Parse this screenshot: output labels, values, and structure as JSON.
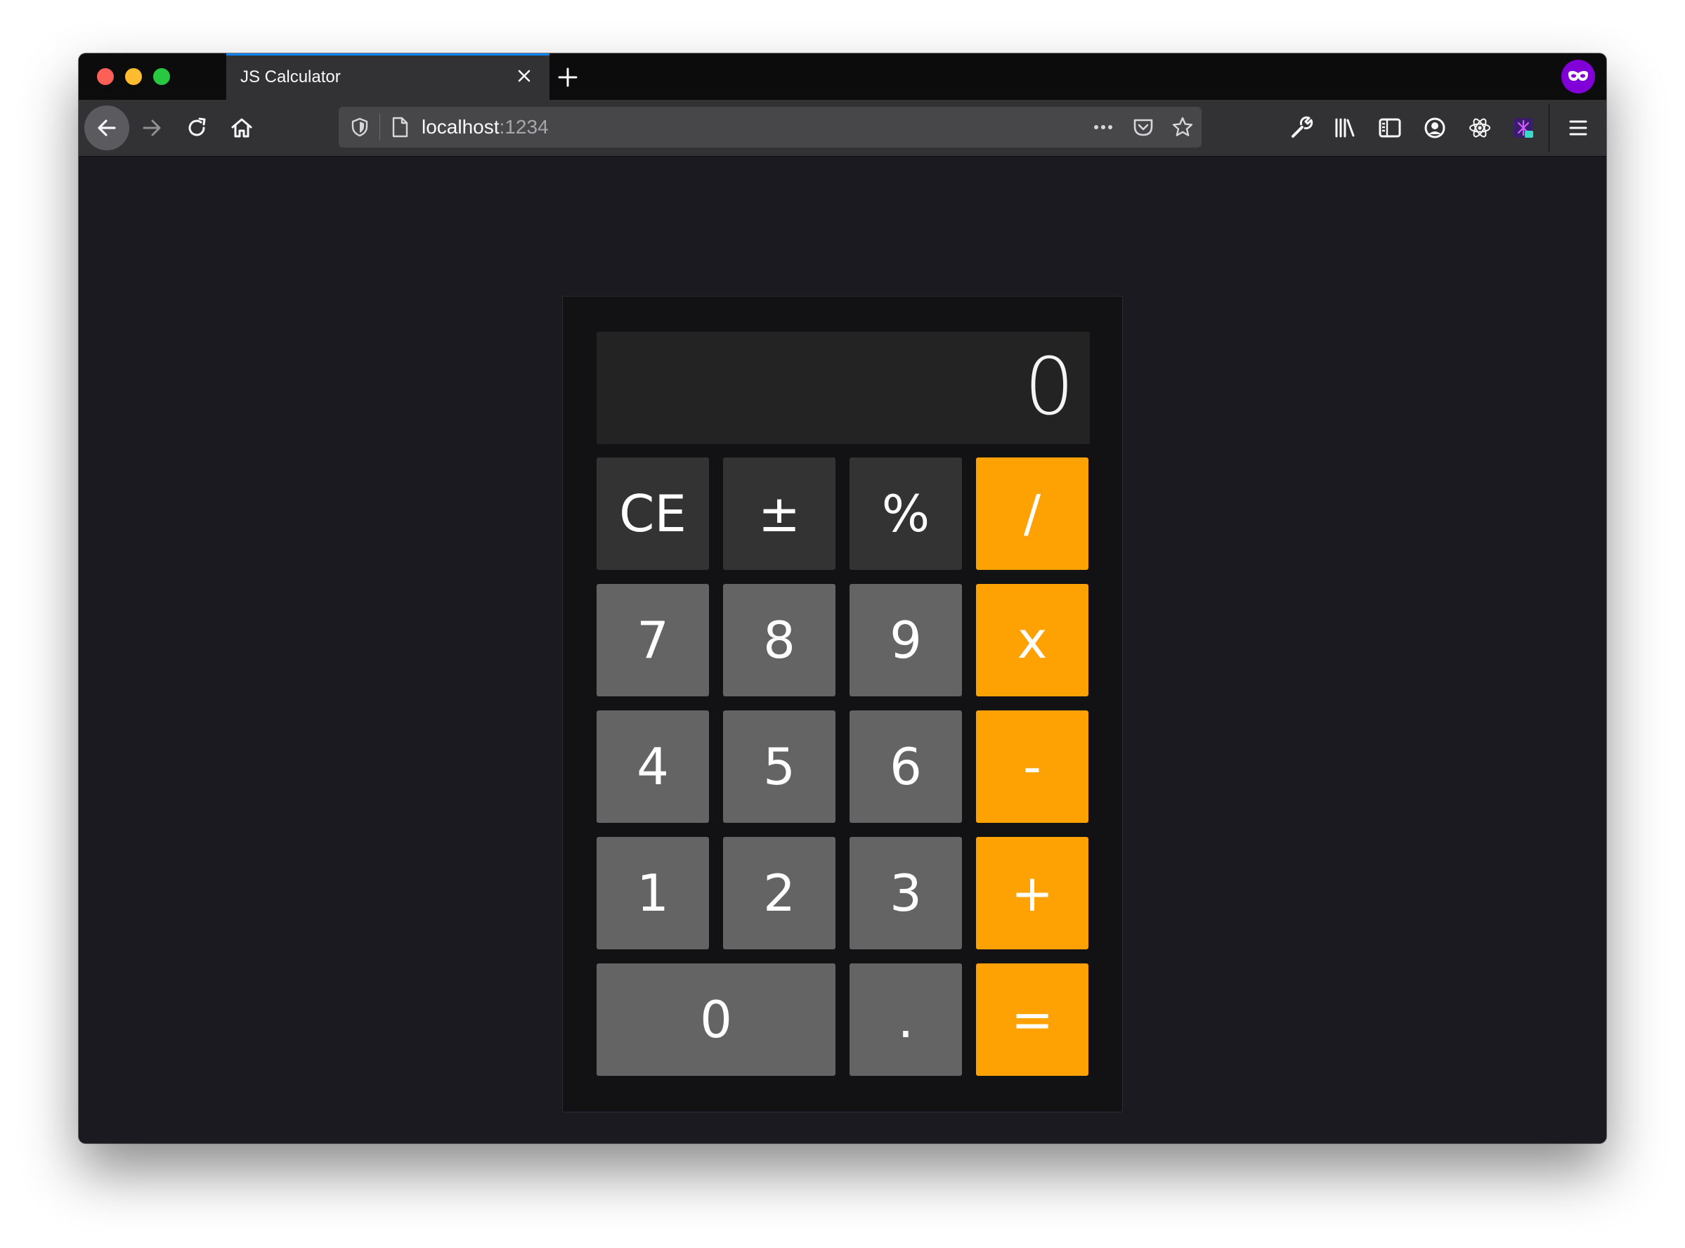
{
  "browser": {
    "tab": {
      "title": "JS Calculator"
    },
    "url": {
      "host": "localhost",
      "port": ":1234"
    }
  },
  "calculator": {
    "display": "0",
    "keys": [
      {
        "label": "CE",
        "kind": "fn",
        "name": "clear-entry-button"
      },
      {
        "label": "±",
        "kind": "fn",
        "name": "toggle-sign-button"
      },
      {
        "label": "%",
        "kind": "fn",
        "name": "percent-button"
      },
      {
        "label": "/",
        "kind": "op",
        "name": "divide-button"
      },
      {
        "label": "7",
        "kind": "num",
        "name": "digit-7-button"
      },
      {
        "label": "8",
        "kind": "num",
        "name": "digit-8-button"
      },
      {
        "label": "9",
        "kind": "num",
        "name": "digit-9-button"
      },
      {
        "label": "x",
        "kind": "op",
        "name": "multiply-button"
      },
      {
        "label": "4",
        "kind": "num",
        "name": "digit-4-button"
      },
      {
        "label": "5",
        "kind": "num",
        "name": "digit-5-button"
      },
      {
        "label": "6",
        "kind": "num",
        "name": "digit-6-button"
      },
      {
        "label": "-",
        "kind": "op",
        "name": "subtract-button"
      },
      {
        "label": "1",
        "kind": "num",
        "name": "digit-1-button"
      },
      {
        "label": "2",
        "kind": "num",
        "name": "digit-2-button"
      },
      {
        "label": "3",
        "kind": "num",
        "name": "digit-3-button"
      },
      {
        "label": "+",
        "kind": "op",
        "name": "add-button"
      },
      {
        "label": "0",
        "kind": "num",
        "name": "digit-0-button"
      },
      {
        "label": ".",
        "kind": "num",
        "name": "decimal-button"
      },
      {
        "label": "=",
        "kind": "op",
        "name": "equals-button"
      }
    ]
  },
  "colors": {
    "traffic_close": "#fe5f57",
    "traffic_minimize": "#febc2e",
    "traffic_maximize": "#28c840",
    "tab_accent": "#0a84ff",
    "private_browsing": "#8000d7",
    "operator_key": "#fda202",
    "number_key": "#646464",
    "function_key": "#333333"
  },
  "icons": {
    "tab_close": "close-icon",
    "new_tab": "plus-icon",
    "private": "private-browsing-mask-icon",
    "back": "arrow-left-icon",
    "forward": "arrow-right-icon",
    "reload": "reload-icon",
    "home": "home-icon",
    "url_shield": "tracking-protection-shield-icon",
    "url_page": "page-icon",
    "url_more": "more-actions-icon",
    "url_pocket": "pocket-icon",
    "url_star": "bookmark-star-icon",
    "toolbar": [
      "wrench-icon",
      "library-icon",
      "sidebar-icon",
      "account-icon",
      "react-devtools-icon",
      "extension-icon",
      "hamburger-menu-icon"
    ]
  }
}
